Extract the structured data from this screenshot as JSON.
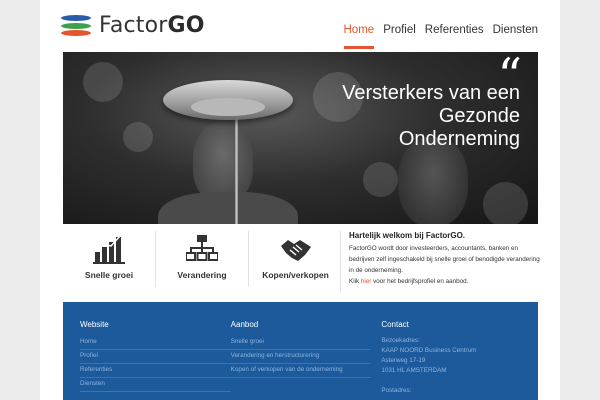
{
  "brand": {
    "name_light": "Factor",
    "name_bold": "GO",
    "colors": {
      "blue": "#2a5da8",
      "green": "#3aa24a",
      "orange": "#e3542f"
    }
  },
  "nav": {
    "items": [
      {
        "label": "Home",
        "active": true
      },
      {
        "label": "Profiel",
        "active": false
      },
      {
        "label": "Referenties",
        "active": false
      },
      {
        "label": "Diensten",
        "active": false
      }
    ]
  },
  "hero": {
    "quote_mark": "“",
    "tagline": [
      "Versterkers van een",
      "Gezonde",
      "Onderneming"
    ]
  },
  "features": [
    {
      "icon": "bar-chart-growth-icon",
      "label": "Snelle groei"
    },
    {
      "icon": "org-chart-icon",
      "label": "Verandering"
    },
    {
      "icon": "handshake-icon",
      "label": "Kopen/verkopen"
    }
  ],
  "welcome": {
    "title": "Hartelijk welkom bij FactorGO.",
    "body": "FactorGO wordt door investeerders, accountants, banken en bedrijven zelf ingeschakeld bij snelle groei of benodigde verandering in de onderneming.",
    "link_prefix": "Klik ",
    "link_text": "hier",
    "link_suffix": " voor het bedrijfsprofiel en aanbod."
  },
  "footer": {
    "website": {
      "heading": "Website",
      "links": [
        "Home",
        "Profiel",
        "Referenties",
        "Diensten"
      ]
    },
    "aanbod": {
      "heading": "Aanbod",
      "links": [
        "Snelle groei",
        "Verandering en herstructurering",
        "Kopen of verkopen van de onderneming"
      ]
    },
    "contact": {
      "heading": "Contact",
      "lines": [
        "Bezoekadres:",
        "KAAP NOORD Business Centrum",
        "Asterweg 17-19",
        "1031 HL AMSTERDAM",
        "",
        "Postadres:"
      ]
    }
  }
}
